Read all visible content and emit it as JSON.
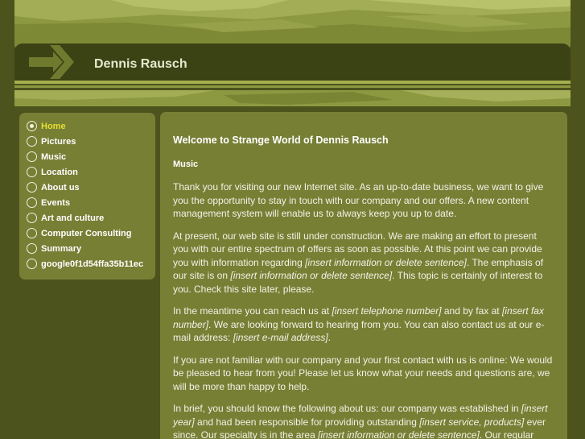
{
  "site": {
    "title": "Dennis Rausch"
  },
  "nav": {
    "items": [
      {
        "label": "Home",
        "active": true
      },
      {
        "label": "Pictures",
        "active": false
      },
      {
        "label": "Music",
        "active": false
      },
      {
        "label": "Location",
        "active": false
      },
      {
        "label": "About us",
        "active": false
      },
      {
        "label": "Events",
        "active": false
      },
      {
        "label": "Art and culture",
        "active": false
      },
      {
        "label": "Computer Consulting",
        "active": false
      },
      {
        "label": "Summary",
        "active": false
      },
      {
        "label": "google0f1d54ffa35b11ec",
        "active": false
      }
    ]
  },
  "content": {
    "heading": "Welcome to Strange World of Dennis Rausch",
    "subheading": "Music",
    "p1": "Thank you for visiting our new Internet site. As an up-to-date business, we want to give you the opportunity to stay in touch with our company and our offers. A new content management system will enable us to always keep you up to date.",
    "p2": [
      "At present, our web site is still under construction. We are making an effort to present you with our entire spectrum of offers as soon as possible. At this point we can provide you with information regarding ",
      "[insert information or delete sentence]",
      ". The emphasis of our site is on ",
      "[insert information or delete sentence]",
      ". This topic is certainly of interest to you. Check this site later, please."
    ],
    "p3": [
      "In the meantime you can reach us at ",
      "[insert telephone number]",
      " and by fax at ",
      "[insert fax number]",
      ". We are looking forward to hearing from you. You can also contact us at our e-mail address: ",
      "[insert e-mail address]",
      "."
    ],
    "p4": "If you are not familiar with our company and your first contact with us is online: We would be pleased to hear from you! Please let us know what your needs and questions are, we will be more than happy to help.",
    "p5": [
      "In brief, you should know the following about us: our company was established in ",
      "[insert year]",
      " and had been responsible for providing outstanding ",
      "[insert service, products]",
      " ever since. Our specialty is in the area ",
      "[insert information or delete sentence]",
      ". Our regular"
    ]
  },
  "colors": {
    "background": "#4d531d",
    "panel": "#777f35",
    "header_light": "#8d9941",
    "header_dark": "#3b4214",
    "active_nav": "#e6df30"
  },
  "icons": {
    "logo": "right-arrow-icon",
    "nav_bullet": "radio-circle-icon"
  }
}
